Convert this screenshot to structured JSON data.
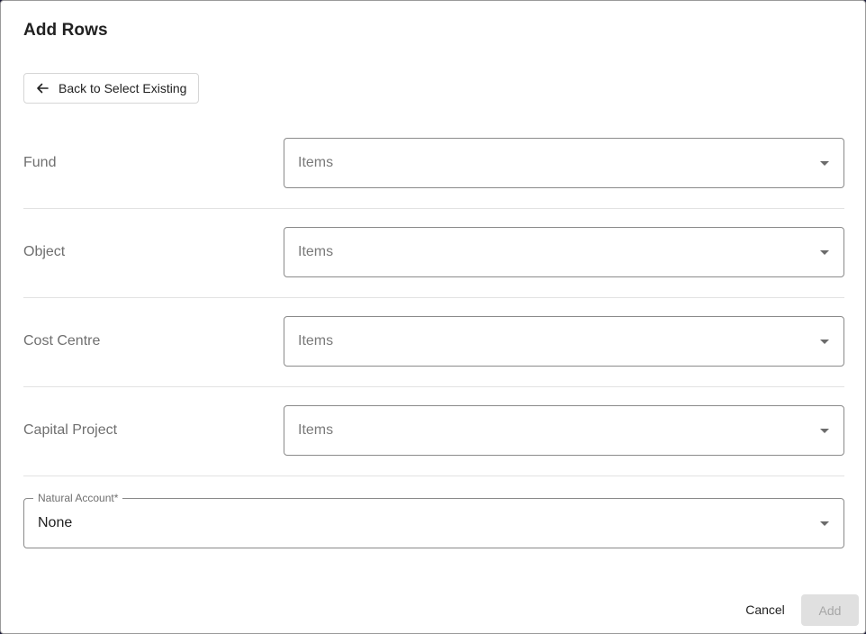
{
  "dialog": {
    "title": "Add Rows",
    "back_button_label": "Back to Select Existing"
  },
  "rows": [
    {
      "label": "Fund",
      "placeholder": "Items"
    },
    {
      "label": "Object",
      "placeholder": "Items"
    },
    {
      "label": "Cost Centre",
      "placeholder": "Items"
    },
    {
      "label": "Capital Project",
      "placeholder": "Items"
    }
  ],
  "natural_account": {
    "label": "Natural Account",
    "required_marker": "*",
    "value": "None"
  },
  "actions": {
    "cancel_label": "Cancel",
    "add_label": "Add"
  },
  "icons": {
    "back": "arrow-left-icon",
    "dropdown": "caret-down-icon"
  }
}
